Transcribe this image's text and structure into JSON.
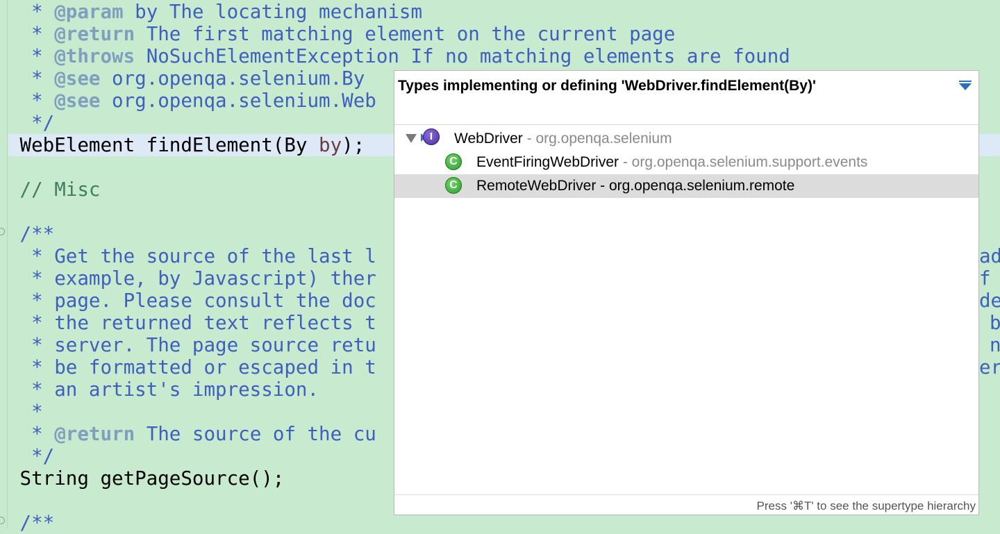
{
  "editor": {
    "lines": [
      {
        "segments": [
          {
            "cls": "c",
            "text": "  * "
          },
          {
            "cls": "t",
            "text": "@param"
          },
          {
            "cls": "c",
            "text": " by The locating mechanism"
          }
        ]
      },
      {
        "segments": [
          {
            "cls": "c",
            "text": "  * "
          },
          {
            "cls": "t",
            "text": "@return"
          },
          {
            "cls": "c",
            "text": " The first matching element on the current page"
          }
        ]
      },
      {
        "segments": [
          {
            "cls": "c",
            "text": "  * "
          },
          {
            "cls": "t",
            "text": "@throws"
          },
          {
            "cls": "c",
            "text": " NoSuchElementException If no matching elements are found"
          }
        ]
      },
      {
        "segments": [
          {
            "cls": "c",
            "text": "  * "
          },
          {
            "cls": "t",
            "text": "@see"
          },
          {
            "cls": "c",
            "text": " org.openqa.selenium.By"
          }
        ]
      },
      {
        "segments": [
          {
            "cls": "c",
            "text": "  * "
          },
          {
            "cls": "t",
            "text": "@see"
          },
          {
            "cls": "c",
            "text": " org.openqa.selenium.Web"
          }
        ]
      },
      {
        "segments": [
          {
            "cls": "c",
            "text": "  */"
          }
        ]
      },
      {
        "current": true,
        "segments": [
          {
            "cls": "",
            "text": " WebElement findElement(By "
          },
          {
            "cls": "p",
            "text": "by"
          },
          {
            "cls": "",
            "text": ");"
          }
        ]
      },
      {
        "segments": [
          {
            "cls": "",
            "text": ""
          }
        ]
      },
      {
        "segments": [
          {
            "cls": "k",
            "text": " // Misc"
          }
        ]
      },
      {
        "segments": [
          {
            "cls": "",
            "text": ""
          }
        ]
      },
      {
        "segments": [
          {
            "cls": "c",
            "text": " /**"
          }
        ]
      },
      {
        "segments": [
          {
            "cls": "c",
            "text": "  * Get the source of the last l"
          }
        ]
      },
      {
        "segments": [
          {
            "cls": "c",
            "text": "  * example, by Javascript) ther"
          }
        ]
      },
      {
        "segments": [
          {
            "cls": "c",
            "text": "  * page. Please consult the doc"
          }
        ]
      },
      {
        "segments": [
          {
            "cls": "c",
            "text": "  * the returned text reflects t"
          }
        ]
      },
      {
        "segments": [
          {
            "cls": "c",
            "text": "  * server. The page source retu"
          }
        ]
      },
      {
        "segments": [
          {
            "cls": "c",
            "text": "  * be formatted or escaped in t"
          }
        ]
      },
      {
        "segments": [
          {
            "cls": "c",
            "text": "  * an artist's impression."
          }
        ]
      },
      {
        "segments": [
          {
            "cls": "c",
            "text": "  *"
          }
        ]
      },
      {
        "segments": [
          {
            "cls": "c",
            "text": "  * "
          },
          {
            "cls": "t",
            "text": "@return"
          },
          {
            "cls": "c",
            "text": " The source of the cu"
          }
        ]
      },
      {
        "segments": [
          {
            "cls": "c",
            "text": "  */"
          }
        ]
      },
      {
        "segments": [
          {
            "cls": "",
            "text": " String getPageSource();"
          }
        ]
      },
      {
        "segments": [
          {
            "cls": "",
            "text": ""
          }
        ]
      },
      {
        "segments": [
          {
            "cls": "c",
            "text": " /**"
          }
        ]
      }
    ],
    "right_fragments": [
      "ad",
      "f",
      "de",
      "b",
      "n",
      "er"
    ]
  },
  "popup": {
    "title": "Types implementing or defining 'WebDriver.findElement(By)'",
    "items": [
      {
        "name": "WebDriver",
        "package": " - org.openqa.selenium",
        "kind": "interface",
        "icon_letter": "I"
      },
      {
        "name": "EventFiringWebDriver",
        "package": " - org.openqa.selenium.support.events",
        "kind": "class",
        "icon_letter": "C"
      },
      {
        "name": "RemoteWebDriver",
        "package": " - org.openqa.selenium.remote",
        "kind": "class",
        "icon_letter": "C",
        "selected": true
      }
    ],
    "footer": "Press '⌘T' to see the supertype hierarchy"
  },
  "colors": {
    "editor_bg": "#c8ebd0",
    "comment": "#3f5fbf",
    "javadoc_tag": "#7f9fbf",
    "line_comment": "#3f7f5f",
    "current_line": "#dde9f6"
  }
}
